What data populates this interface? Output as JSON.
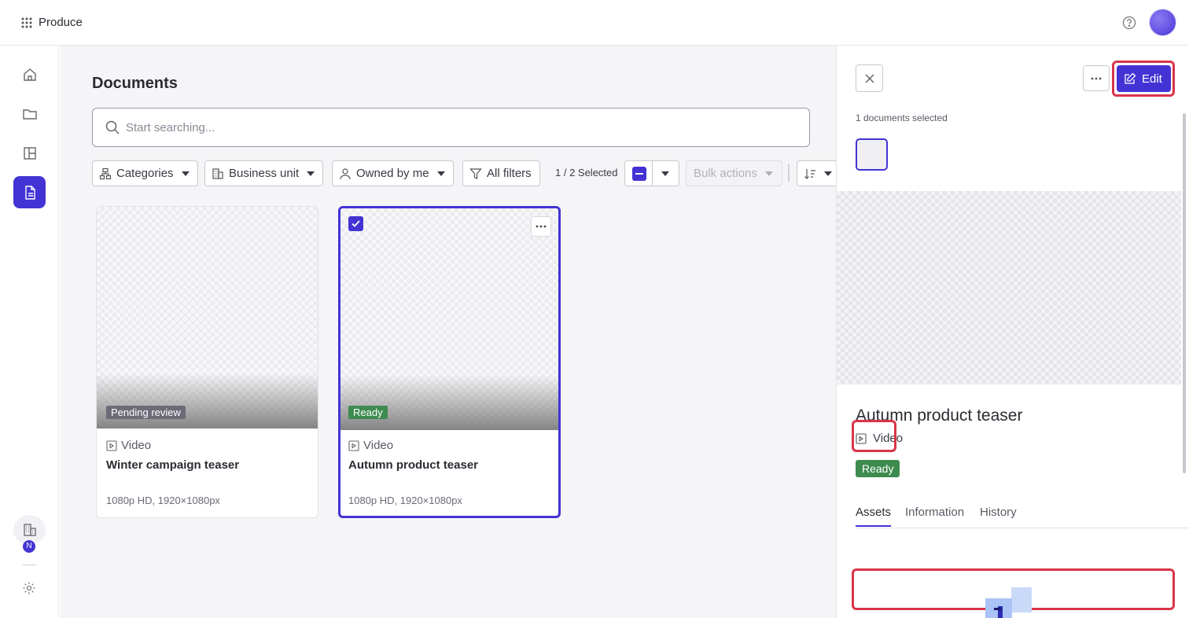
{
  "app": {
    "title": "Produce"
  },
  "page": {
    "title": "Documents",
    "search": {
      "placeholder": "Start searching...",
      "value": ""
    }
  },
  "filters": {
    "categories": "Categories",
    "business_unit": "Business unit",
    "owned_by_me": "Owned by me",
    "all_filters": "All filters",
    "selection_count": "1 / 2 Selected",
    "bulk_actions": "Bulk actions"
  },
  "cards": [
    {
      "status": "Pending review",
      "type": "Video",
      "title": "Winter campaign teaser",
      "meta": "1080p HD, 1920×1080px",
      "selected": false
    },
    {
      "status": "Ready",
      "type": "Video",
      "title": "Autumn product teaser",
      "meta": "1080p HD, 1920×1080px",
      "selected": true
    }
  ],
  "sidebar": {
    "org_badge": "N",
    "items": [
      {
        "icon": "home-icon"
      },
      {
        "icon": "folder-icon"
      },
      {
        "icon": "layout-icon"
      },
      {
        "icon": "document-icon",
        "active": true
      }
    ]
  },
  "panel": {
    "edit_label": "Edit",
    "selected_label": "1 documents selected",
    "doc_title": "Autumn product teaser",
    "doc_type": "Video",
    "doc_status": "Ready",
    "tabs": [
      "Assets",
      "Information",
      "History"
    ],
    "active_tab": "Assets"
  },
  "colors": {
    "accent": "#4433d4",
    "ready": "#3d8b4f",
    "pending": "#6c6c78",
    "highlight": "#d9344a"
  }
}
